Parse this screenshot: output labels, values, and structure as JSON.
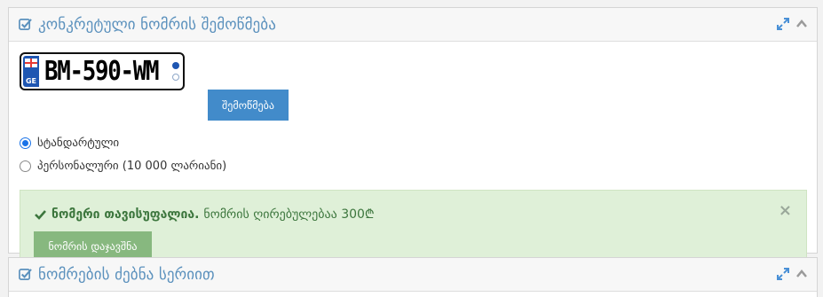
{
  "panel1": {
    "title": "კონკრეტული ნომრის შემოწმება",
    "header_icon": "check-square-icon",
    "tools": [
      "expand-icon",
      "chevron-up-icon"
    ],
    "plate": {
      "number": "BM-590-WM",
      "country_code": "GE"
    },
    "check_button_label": "შემოწმება",
    "options": [
      {
        "label": "სტანდარტული",
        "checked": true
      },
      {
        "label": "პერსონალური (10 000 ლარიანი)",
        "checked": false
      }
    ],
    "alert": {
      "icon": "check-icon",
      "bold_text": "ნომერი თავისუფალია.",
      "text": "ნომრის ღირებულებაა 300₾",
      "close_label": "×",
      "reserve_button_label": "ნომრის დაჯავშნა"
    }
  },
  "panel2": {
    "title": "ნომრების ძებნა სერიით",
    "header_icon": "check-square-icon",
    "tools": [
      "expand-icon",
      "chevron-up-icon"
    ]
  },
  "colors": {
    "title": "#5b91bd",
    "primary_button": "#428bca",
    "success_bg": "#dff0d8",
    "success_text": "#3c763d",
    "success_button": "#87b87f",
    "radio_active": "#1a73e8",
    "plate_blue": "#1e56b2"
  }
}
